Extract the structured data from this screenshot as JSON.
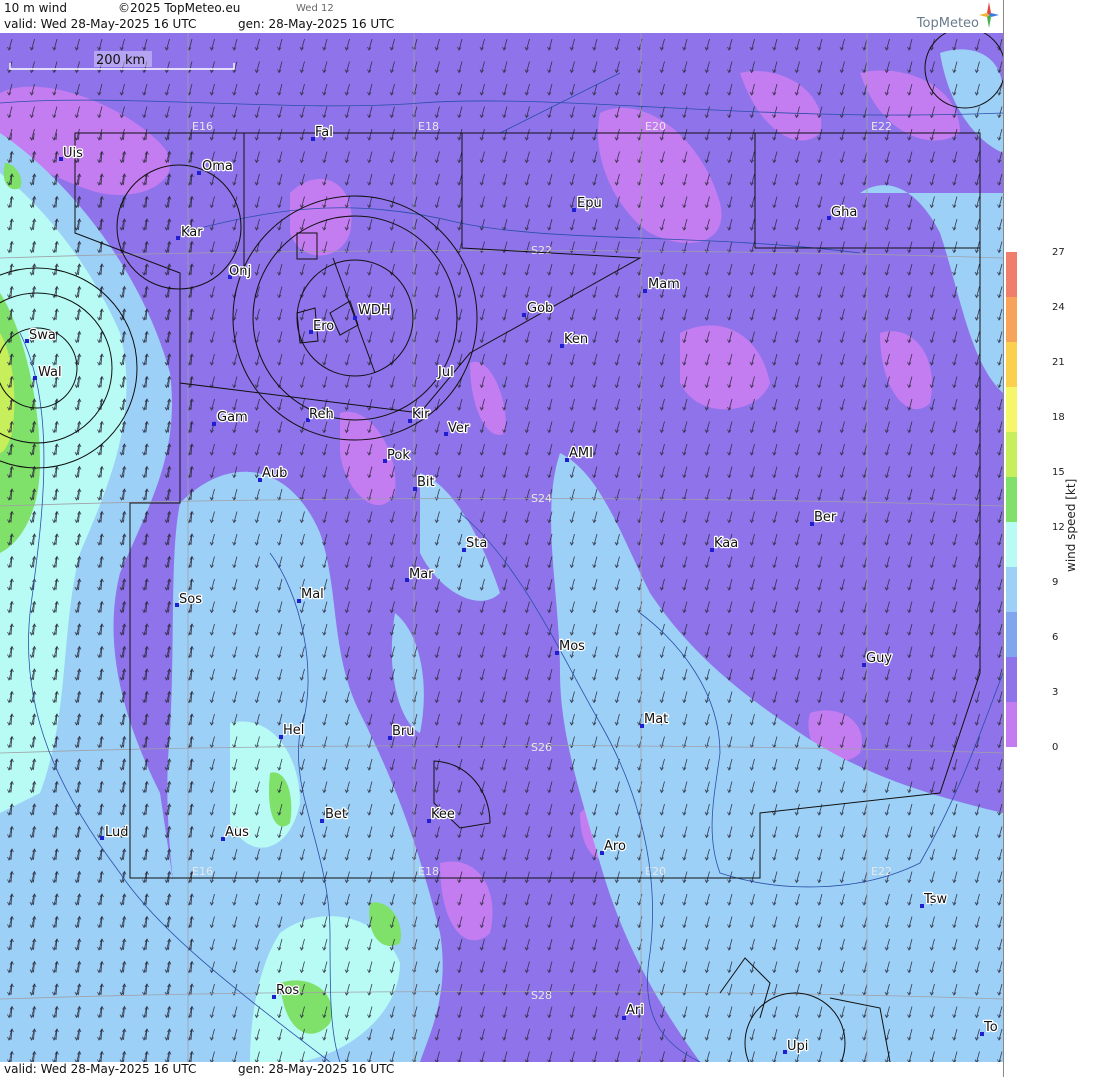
{
  "header": {
    "product": "10 m wind",
    "copyright": "©2025 TopMeteo.eu",
    "day": "Wed 12",
    "valid": "valid:  Wed  28-May-2025  16 UTC",
    "generated": "gen: 28-May-2025 16 UTC",
    "logo": "TopMeteo"
  },
  "footer": {
    "valid": "valid:  Wed  28-May-2025  16 UTC",
    "generated": "gen: 28-May-2025 16 UTC"
  },
  "scale_bar": {
    "label": "200 km"
  },
  "grid_labels": {
    "lon_top": [
      "E16",
      "E18",
      "E20",
      "E22"
    ],
    "lon_bottom": [
      "E16",
      "E18",
      "E20",
      "E22"
    ],
    "lat": [
      "S22",
      "S24",
      "S26",
      "S28"
    ]
  },
  "places": [
    "Uis",
    "Fal",
    "Oma",
    "Kar",
    "Onj",
    "Epu",
    "Gha",
    "Mam",
    "Gob",
    "Swa",
    "Wal",
    "Ero",
    "WDH",
    "Ken",
    "Jul",
    "Gam",
    "Reh",
    "Kir",
    "Ver",
    "AMI",
    "Aub",
    "Pok",
    "Bit",
    "Ber",
    "Sta",
    "Kaa",
    "Mar",
    "Sos",
    "Mal",
    "Mos",
    "Guy",
    "Mat",
    "Hel",
    "Bru",
    "Lud",
    "Aus",
    "Bet",
    "Kee",
    "Aro",
    "Tsw",
    "Ros",
    "Ari",
    "To",
    "Upi"
  ],
  "legend": {
    "title": "wind speed [kt]",
    "ticks": [
      "27",
      "24",
      "21",
      "18",
      "15",
      "12",
      "9",
      "6",
      "3",
      "0"
    ],
    "colors": [
      "#ef7f6a",
      "#f7a35a",
      "#fbd04e",
      "#f6f66a",
      "#c7ee5b",
      "#7fe06a",
      "#b8fbf5",
      "#9cd0f7",
      "#7fa6ef",
      "#8e73ea",
      "#c47cf1"
    ]
  }
}
